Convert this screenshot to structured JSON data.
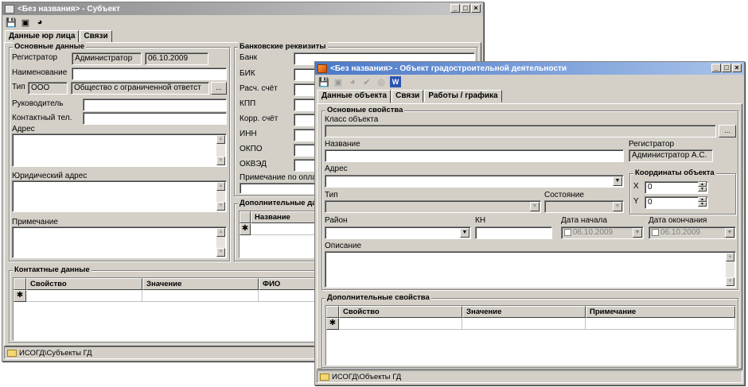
{
  "win1": {
    "title": "<Без названия> - Субъект",
    "tabs": [
      "Данные юр лица",
      "Связи"
    ],
    "main_group": "Основные данные",
    "registrator_label": "Регистратор",
    "registrator_value": "Администратор",
    "date_value": "06.10.2009",
    "name_label": "Наименование",
    "type_label": "Тип",
    "type_code": "ООО",
    "type_name": "Общество с ограниченной ответст",
    "ellipsis": "...",
    "head_label": "Руководитель",
    "phone_label": "Контактный тел.",
    "address_label": "Адрес",
    "legal_address_label": "Юридический адрес",
    "note_label": "Примечание",
    "bank_group": "Банковские реквизиты",
    "bank_labels": [
      "Банк",
      "БИК",
      "Расч. счёт",
      "КПП",
      "Корр. счёт",
      "ИНН",
      "ОКПО",
      "ОКВЭД"
    ],
    "pay_note_label": "Примечание по опла",
    "extra_group": "Дополнительные да",
    "extra_col": "Название",
    "contacts_group": "Контактные данные",
    "contacts_cols": [
      "Свойство",
      "Значение",
      "ФИО"
    ],
    "row_marker": "✱",
    "status": "ИСОГД\\Субъекты ГД"
  },
  "win2": {
    "title": "<Без названия> - Объект градостроительной деятельности",
    "tabs": [
      "Данные объекта",
      "Связи",
      "Работы / графика"
    ],
    "main_group": "Основные свойства",
    "class_label": "Класс объекта",
    "ellipsis": "...",
    "name_label": "Название",
    "registrator_label": "Регистратор",
    "registrator_value": "Администратор А.С.",
    "address_label": "Адрес",
    "coords_group": "Координаты объекта",
    "x_label": "X",
    "x_value": "0",
    "y_label": "Y",
    "y_value": "0",
    "type_label": "Тип",
    "state_label": "Состояние",
    "district_label": "Район",
    "kn_label": "КН",
    "start_label": "Дата начала",
    "start_value": "06.10.2009",
    "end_label": "Дата окончания",
    "end_value": "06.10.2009",
    "desc_label": "Описание",
    "extra_group": "Дополнительные свойства",
    "extra_cols": [
      "Свойство",
      "Значение",
      "Примечание"
    ],
    "row_marker": "✱",
    "status": "ИСОГД\\Объекты ГД"
  }
}
